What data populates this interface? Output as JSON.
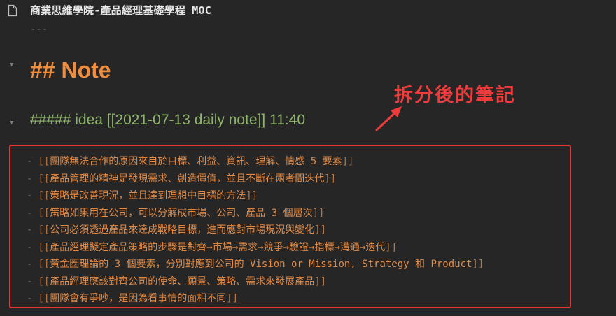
{
  "header": {
    "title": "商業思維學院-產品經理基礎學程 MOC",
    "file_icon": "file-icon"
  },
  "frontmatter_dashes": "---",
  "heading2": "## Note",
  "heading5": "##### idea [[2021-07-13 daily note]] 11:40",
  "annotation": {
    "text": "拆分後的筆記",
    "color": "#ee3b3b"
  },
  "list": {
    "bullet": "-",
    "open": "[[",
    "close": "]]",
    "items": [
      "團隊無法合作的原因來自於目標、利益、資訊、理解、情感 5 要素",
      "產品管理的精神是發現需求、創造價值，並且不斷在兩者間迭代",
      "策略是改善現況，並且達到理想中目標的方法",
      "策略如果用在公司，可以分解成市場、公司、產品 3 個層次",
      "公司必須透過產品來達成戰略目標，進而應對市場現況與變化",
      "產品經理擬定產品策略的步驟是對齊→市場→需求→競爭→驗證→指標→溝通→迭代",
      "黃金圈理論的 3 個要素，分別對應到公司的 Vision or Mission, Strategy 和 Product",
      "產品經理應該對齊公司的使命、願景、策略、需求來發展產品",
      "團隊會有爭吵，是因為看事情的面相不同"
    ]
  },
  "colors": {
    "background": "#262626",
    "heading2": "#f08d3c",
    "heading5": "#8fb56c",
    "link": "#e18a45",
    "highlight_box": "#e53535"
  }
}
